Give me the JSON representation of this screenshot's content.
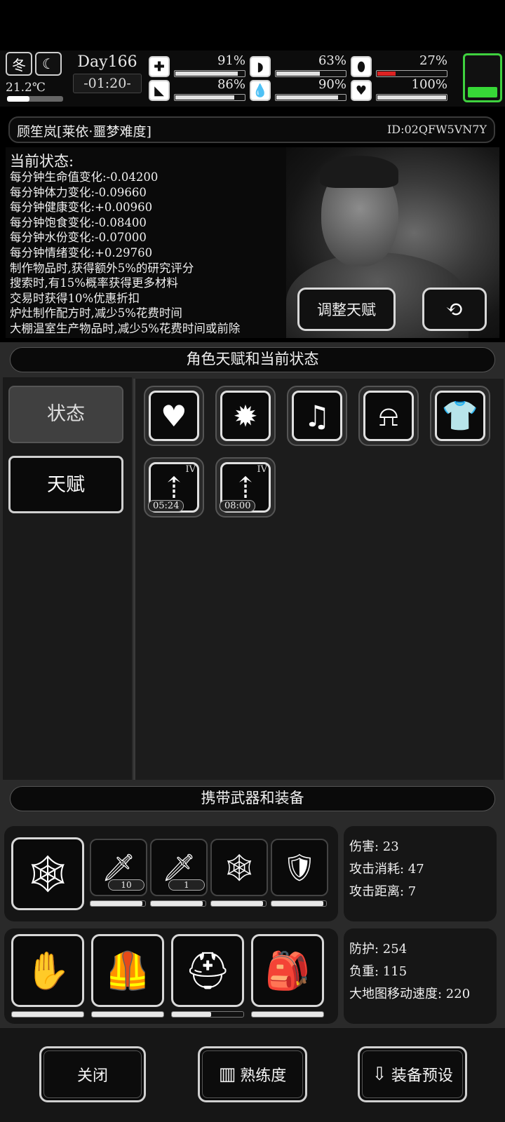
{
  "top": {
    "season": "冬",
    "temperature": "21.2℃",
    "day": "Day166",
    "clock": "-01:20-",
    "stats": [
      {
        "name": "health-kit",
        "icon": "✚",
        "pct": "91%",
        "value": 0.91
      },
      {
        "name": "stomach",
        "icon": "◗",
        "pct": "63%",
        "value": 0.63
      },
      {
        "name": "bladder",
        "icon": "⬮",
        "pct": "27%",
        "value": 0.27
      },
      {
        "name": "stamina",
        "icon": "◣",
        "pct": "86%",
        "value": 0.86
      },
      {
        "name": "water",
        "icon": "💧",
        "pct": "90%",
        "value": 0.9
      },
      {
        "name": "mood",
        "icon": "♥",
        "pct": "100%",
        "value": 1.0
      }
    ],
    "battery_level": 0.24
  },
  "character": {
    "name": "顾笙岚[莱依·噩梦难度]",
    "player_id": "ID:02QFW5VN7Y"
  },
  "status": {
    "title": "当前状态:",
    "lines": [
      "每分钟生命值变化:-0.04200",
      "每分钟体力变化:-0.09660",
      "每分钟健康变化:+0.00960",
      "每分钟饱食变化:-0.08400",
      "每分钟水份变化:-0.07000",
      "每分钟情绪变化:+0.29760",
      "制作物品时,获得额外5%的研究评分",
      "搜索时,有15%概率获得更多材料",
      "交易时获得10%优惠折扣",
      "炉灶制作配方时,减少5%花费时间",
      "大棚温室生产物品时,减少5%花费时间或前除"
    ],
    "adjust_label": "调整天赋"
  },
  "talents_section": {
    "header": "角色天赋和当前状态",
    "tabs": [
      "状态",
      "天赋"
    ],
    "buffs": [
      {
        "icon": "♥",
        "level": "",
        "timer": ""
      },
      {
        "icon": "✹",
        "level": "",
        "timer": ""
      },
      {
        "icon": "♫",
        "level": "",
        "timer": ""
      },
      {
        "icon": "⍾",
        "level": "",
        "timer": ""
      },
      {
        "icon": "👕",
        "level": "",
        "timer": ""
      },
      {
        "icon": "⇡",
        "level": "IV",
        "timer": "05:24"
      },
      {
        "icon": "⇡",
        "level": "IV",
        "timer": "08:00"
      }
    ]
  },
  "equipment_section": {
    "header": "携带武器和装备",
    "weapon": {
      "icon": "🕸"
    },
    "weapon_slots": [
      {
        "icon": "🗡",
        "count": "10",
        "durability": 0.95
      },
      {
        "icon": "🗡",
        "count": "1",
        "durability": 0.95
      },
      {
        "icon": "🕸",
        "count": "",
        "durability": 0.95
      },
      {
        "icon": "🛡",
        "count": "",
        "durability": 0.95
      }
    ],
    "weapon_stats": [
      "伤害: 23",
      "攻击消耗: 47",
      "攻击距离: 7"
    ],
    "armor_slots": [
      {
        "icon": "✋",
        "durability": 1.0
      },
      {
        "icon": "🦺",
        "durability": 1.0
      },
      {
        "icon": "⛑",
        "durability": 0.55
      },
      {
        "icon": "🎒",
        "durability": 1.0
      }
    ],
    "armor_stats": [
      "防护: 254",
      "负重: 115",
      "大地图移动速度: 220"
    ]
  },
  "bottom": {
    "close": "关闭",
    "proficiency": "熟练度",
    "preset": "装备预设"
  }
}
